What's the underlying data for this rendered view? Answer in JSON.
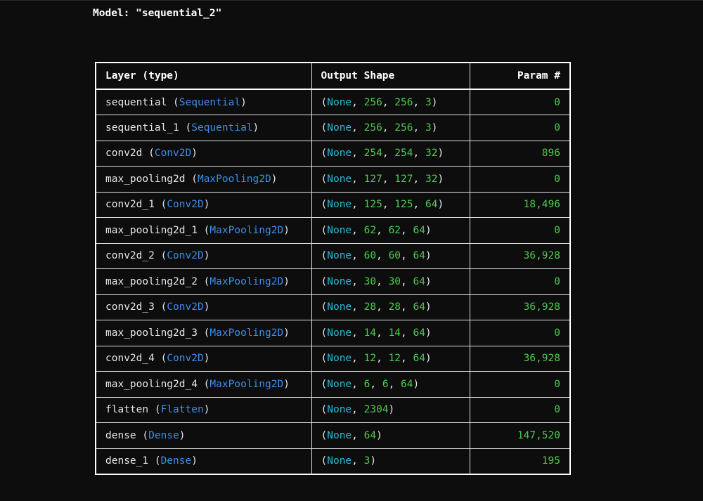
{
  "model_title": "Model: \"sequential_2\"",
  "headers": {
    "layer": "Layer (type)",
    "output_shape": "Output Shape",
    "param": "Param #"
  },
  "colors": {
    "background": "#0d0d0d",
    "text": "#e6e6e6",
    "type_name": "#3b8eea",
    "none_keyword": "#29b8db",
    "number": "#4ec94e"
  },
  "rows": [
    {
      "name": "sequential",
      "type": "Sequential",
      "shape": [
        "256",
        "256",
        "3"
      ],
      "params": "0"
    },
    {
      "name": "sequential_1",
      "type": "Sequential",
      "shape": [
        "256",
        "256",
        "3"
      ],
      "params": "0"
    },
    {
      "name": "conv2d",
      "type": "Conv2D",
      "shape": [
        "254",
        "254",
        "32"
      ],
      "params": "896"
    },
    {
      "name": "max_pooling2d",
      "type": "MaxPooling2D",
      "shape": [
        "127",
        "127",
        "32"
      ],
      "params": "0"
    },
    {
      "name": "conv2d_1",
      "type": "Conv2D",
      "shape": [
        "125",
        "125",
        "64"
      ],
      "params": "18,496"
    },
    {
      "name": "max_pooling2d_1",
      "type": "MaxPooling2D",
      "shape": [
        "62",
        "62",
        "64"
      ],
      "params": "0"
    },
    {
      "name": "conv2d_2",
      "type": "Conv2D",
      "shape": [
        "60",
        "60",
        "64"
      ],
      "params": "36,928"
    },
    {
      "name": "max_pooling2d_2",
      "type": "MaxPooling2D",
      "shape": [
        "30",
        "30",
        "64"
      ],
      "params": "0"
    },
    {
      "name": "conv2d_3",
      "type": "Conv2D",
      "shape": [
        "28",
        "28",
        "64"
      ],
      "params": "36,928"
    },
    {
      "name": "max_pooling2d_3",
      "type": "MaxPooling2D",
      "shape": [
        "14",
        "14",
        "64"
      ],
      "params": "0"
    },
    {
      "name": "conv2d_4",
      "type": "Conv2D",
      "shape": [
        "12",
        "12",
        "64"
      ],
      "params": "36,928"
    },
    {
      "name": "max_pooling2d_4",
      "type": "MaxPooling2D",
      "shape": [
        "6",
        "6",
        "64"
      ],
      "params": "0"
    },
    {
      "name": "flatten",
      "type": "Flatten",
      "shape": [
        "2304"
      ],
      "params": "0"
    },
    {
      "name": "dense",
      "type": "Dense",
      "shape": [
        "64"
      ],
      "params": "147,520"
    },
    {
      "name": "dense_1",
      "type": "Dense",
      "shape": [
        "3"
      ],
      "params": "195"
    }
  ],
  "none_keyword": "None"
}
